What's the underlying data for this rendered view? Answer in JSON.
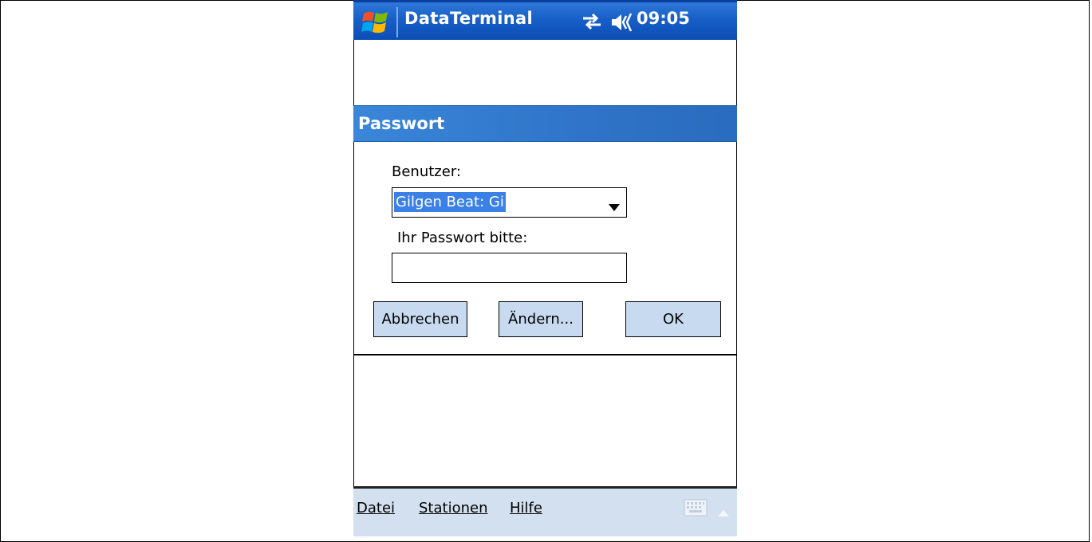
{
  "titlebar": {
    "app_title": "DataTerminal",
    "time": "09:05",
    "start_icon": "windows-flag-icon",
    "connectivity_icon": "connectivity-arrows-icon",
    "volume_icon": "speaker-icon"
  },
  "dialog": {
    "title": "Passwort",
    "user_label": "Benutzer:",
    "user_selected": "Gilgen Beat: Gi",
    "password_label": "Ihr Passwort bitte:",
    "password_value": "",
    "buttons": {
      "cancel": "Abbrechen",
      "change": "Ändern...",
      "ok": "OK"
    }
  },
  "menubar": {
    "items": [
      "Datei",
      "Stationen",
      "Hilfe"
    ],
    "keyboard_icon": "keyboard-icon",
    "sip_arrow_icon": "up-arrow-icon"
  },
  "colors": {
    "titlebar": "#175fc7",
    "dialog_header": "#3a86d8",
    "selection": "#3b80e6",
    "button_face": "#c8daf0",
    "menubar": "#d3e0ef"
  }
}
